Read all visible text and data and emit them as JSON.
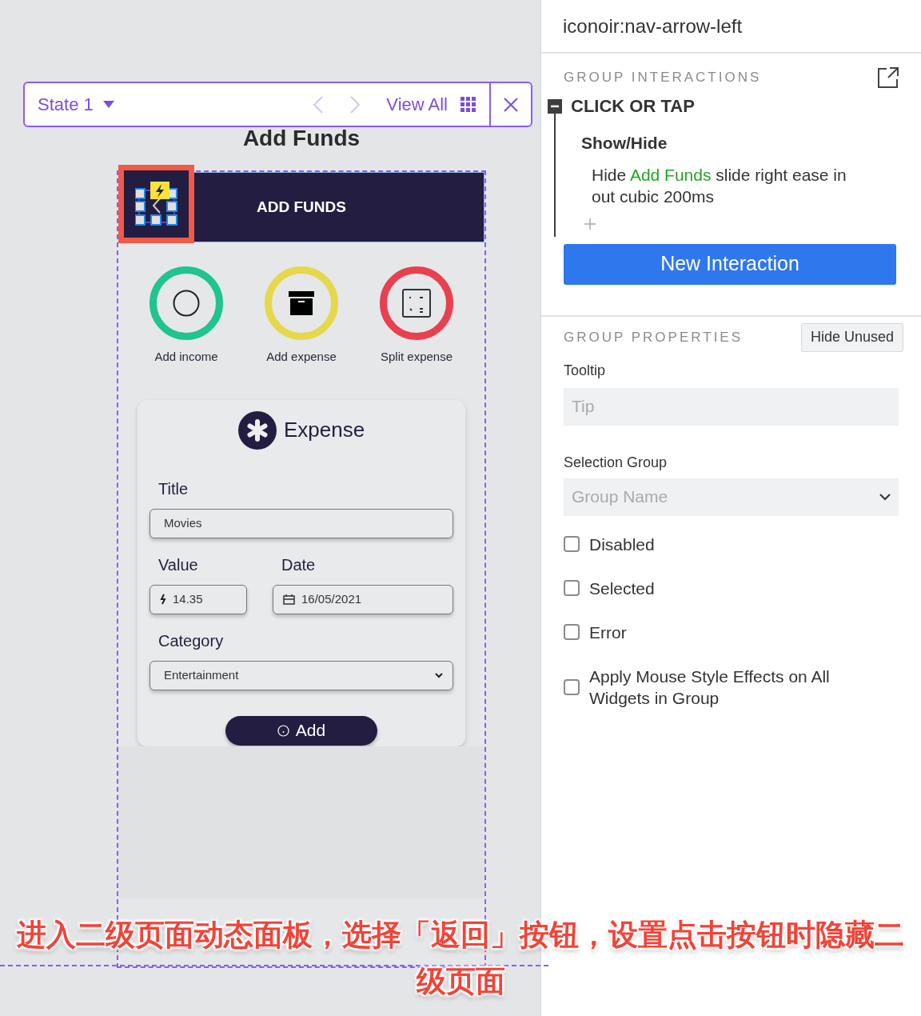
{
  "state_bar": {
    "state": "State 1",
    "view_all": "View All"
  },
  "canvas_title": "Add Funds",
  "app": {
    "header_title": "ADD FUNDS",
    "actions": [
      {
        "label": "Add income",
        "color": "#1fc48e",
        "kind": "income"
      },
      {
        "label": "Add expense",
        "color": "#e6d84a",
        "kind": "expense"
      },
      {
        "label": "Split expense",
        "color": "#e8404f",
        "kind": "split"
      }
    ],
    "form": {
      "heading": "Expense",
      "title_field": {
        "label": "Title",
        "value": "Movies"
      },
      "value_field": {
        "label": "Value",
        "value": "14.35"
      },
      "date_field": {
        "label": "Date",
        "value": "16/05/2021"
      },
      "category_field": {
        "label": "Category",
        "value": "Entertainment"
      },
      "submit": "Add"
    }
  },
  "panel": {
    "element_name": "iconoir:nav-arrow-left",
    "interactions": {
      "heading": "GROUP INTERACTIONS",
      "event": {
        "label": "CLICK OR TAP",
        "expanded": true
      },
      "actions": [
        {
          "heading": "Show/Hide",
          "parts": [
            {
              "kind": "plain",
              "text": "Hide "
            },
            {
              "kind": "target",
              "text": "Add Funds"
            },
            {
              "kind": "plain",
              "text": " slide right ease in out cubic 200ms"
            }
          ]
        }
      ],
      "new_button": "New Interaction"
    },
    "properties": {
      "heading": "GROUP PROPERTIES",
      "hide_unused": "Hide Unused",
      "tooltip": {
        "label": "Tooltip",
        "placeholder": "Tip"
      },
      "selection_group": {
        "label": "Selection Group",
        "placeholder": "Group Name"
      },
      "options": [
        {
          "label": "Disabled",
          "checked": false
        },
        {
          "label": "Selected",
          "checked": false
        },
        {
          "label": "Error",
          "checked": false
        },
        {
          "label": "Apply Mouse Style Effects on All Widgets in Group",
          "checked": false
        }
      ]
    }
  },
  "caption": [
    "进入二级页面动态面板，选择「返回」按钮，设置点击按钮时隐藏二",
    "级页面"
  ]
}
